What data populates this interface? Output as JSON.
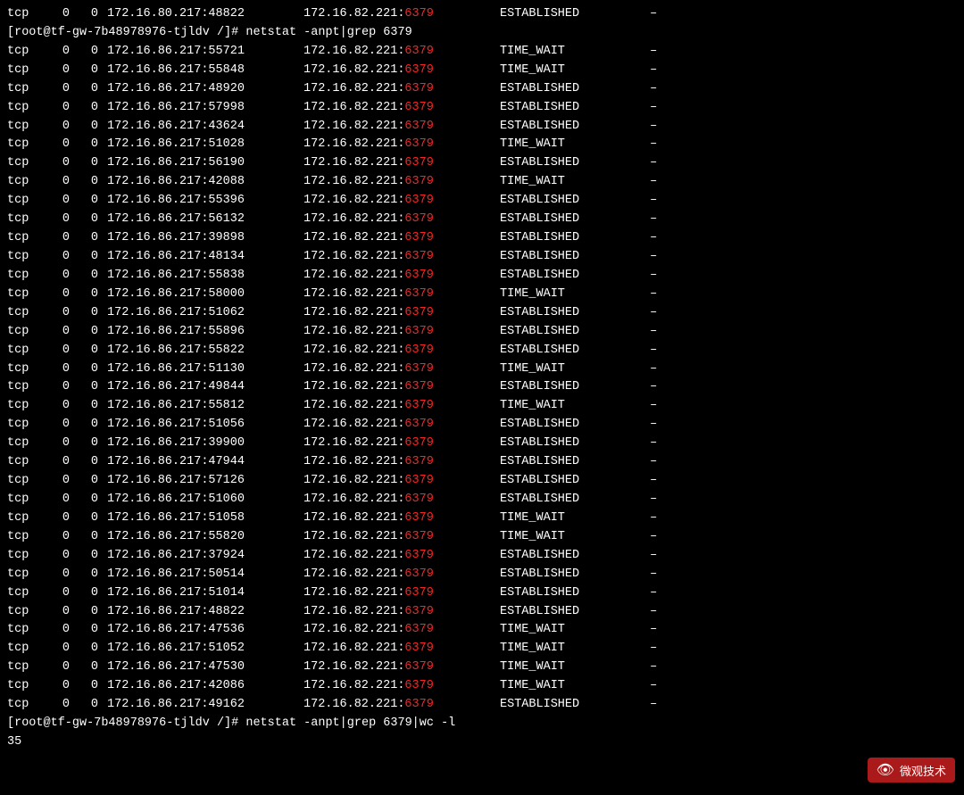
{
  "terminal": {
    "prompt1": "[root@tf-gw-7b48978976-tjldv /]# netstat -anpt|grep 6379",
    "prompt2": "[root@tf-gw-7b48978976-tjldv /]# netstat -anpt|grep 6379|wc -l",
    "count": "35",
    "foreign_base": "172.16.82.221:",
    "port": "6379",
    "rows": [
      {
        "proto": "tcp",
        "recv": "0",
        "send": "0",
        "local": "172.16.86.217:55721",
        "foreign_port": "6379",
        "state": "TIME_WAIT"
      },
      {
        "proto": "tcp",
        "recv": "0",
        "send": "0",
        "local": "172.16.86.217:55848",
        "foreign_port": "6379",
        "state": "TIME_WAIT"
      },
      {
        "proto": "tcp",
        "recv": "0",
        "send": "0",
        "local": "172.16.86.217:48920",
        "foreign_port": "6379",
        "state": "ESTABLISHED"
      },
      {
        "proto": "tcp",
        "recv": "0",
        "send": "0",
        "local": "172.16.86.217:57998",
        "foreign_port": "6379",
        "state": "ESTABLISHED"
      },
      {
        "proto": "tcp",
        "recv": "0",
        "send": "0",
        "local": "172.16.86.217:43624",
        "foreign_port": "6379",
        "state": "ESTABLISHED"
      },
      {
        "proto": "tcp",
        "recv": "0",
        "send": "0",
        "local": "172.16.86.217:51028",
        "foreign_port": "6379",
        "state": "TIME_WAIT"
      },
      {
        "proto": "tcp",
        "recv": "0",
        "send": "0",
        "local": "172.16.86.217:56190",
        "foreign_port": "6379",
        "state": "ESTABLISHED"
      },
      {
        "proto": "tcp",
        "recv": "0",
        "send": "0",
        "local": "172.16.86.217:42088",
        "foreign_port": "6379",
        "state": "TIME_WAIT"
      },
      {
        "proto": "tcp",
        "recv": "0",
        "send": "0",
        "local": "172.16.86.217:55396",
        "foreign_port": "6379",
        "state": "ESTABLISHED"
      },
      {
        "proto": "tcp",
        "recv": "0",
        "send": "0",
        "local": "172.16.86.217:56132",
        "foreign_port": "6379",
        "state": "ESTABLISHED"
      },
      {
        "proto": "tcp",
        "recv": "0",
        "send": "0",
        "local": "172.16.86.217:39898",
        "foreign_port": "6379",
        "state": "ESTABLISHED"
      },
      {
        "proto": "tcp",
        "recv": "0",
        "send": "0",
        "local": "172.16.86.217:48134",
        "foreign_port": "6379",
        "state": "ESTABLISHED"
      },
      {
        "proto": "tcp",
        "recv": "0",
        "send": "0",
        "local": "172.16.86.217:55838",
        "foreign_port": "6379",
        "state": "ESTABLISHED"
      },
      {
        "proto": "tcp",
        "recv": "0",
        "send": "0",
        "local": "172.16.86.217:58000",
        "foreign_port": "6379",
        "state": "TIME_WAIT"
      },
      {
        "proto": "tcp",
        "recv": "0",
        "send": "0",
        "local": "172.16.86.217:51062",
        "foreign_port": "6379",
        "state": "ESTABLISHED"
      },
      {
        "proto": "tcp",
        "recv": "0",
        "send": "0",
        "local": "172.16.86.217:55896",
        "foreign_port": "6379",
        "state": "ESTABLISHED"
      },
      {
        "proto": "tcp",
        "recv": "0",
        "send": "0",
        "local": "172.16.86.217:55822",
        "foreign_port": "6379",
        "state": "ESTABLISHED"
      },
      {
        "proto": "tcp",
        "recv": "0",
        "send": "0",
        "local": "172.16.86.217:51130",
        "foreign_port": "6379",
        "state": "TIME_WAIT"
      },
      {
        "proto": "tcp",
        "recv": "0",
        "send": "0",
        "local": "172.16.86.217:49844",
        "foreign_port": "6379",
        "state": "ESTABLISHED"
      },
      {
        "proto": "tcp",
        "recv": "0",
        "send": "0",
        "local": "172.16.86.217:55812",
        "foreign_port": "6379",
        "state": "TIME_WAIT"
      },
      {
        "proto": "tcp",
        "recv": "0",
        "send": "0",
        "local": "172.16.86.217:51056",
        "foreign_port": "6379",
        "state": "ESTABLISHED"
      },
      {
        "proto": "tcp",
        "recv": "0",
        "send": "0",
        "local": "172.16.86.217:39900",
        "foreign_port": "6379",
        "state": "ESTABLISHED"
      },
      {
        "proto": "tcp",
        "recv": "0",
        "send": "0",
        "local": "172.16.86.217:47944",
        "foreign_port": "6379",
        "state": "ESTABLISHED"
      },
      {
        "proto": "tcp",
        "recv": "0",
        "send": "0",
        "local": "172.16.86.217:57126",
        "foreign_port": "6379",
        "state": "ESTABLISHED"
      },
      {
        "proto": "tcp",
        "recv": "0",
        "send": "0",
        "local": "172.16.86.217:51060",
        "foreign_port": "6379",
        "state": "ESTABLISHED"
      },
      {
        "proto": "tcp",
        "recv": "0",
        "send": "0",
        "local": "172.16.86.217:51058",
        "foreign_port": "6379",
        "state": "TIME_WAIT"
      },
      {
        "proto": "tcp",
        "recv": "0",
        "send": "0",
        "local": "172.16.86.217:55820",
        "foreign_port": "6379",
        "state": "TIME_WAIT"
      },
      {
        "proto": "tcp",
        "recv": "0",
        "send": "0",
        "local": "172.16.86.217:37924",
        "foreign_port": "6379",
        "state": "ESTABLISHED"
      },
      {
        "proto": "tcp",
        "recv": "0",
        "send": "0",
        "local": "172.16.86.217:50514",
        "foreign_port": "6379",
        "state": "ESTABLISHED"
      },
      {
        "proto": "tcp",
        "recv": "0",
        "send": "0",
        "local": "172.16.86.217:51014",
        "foreign_port": "6379",
        "state": "ESTABLISHED"
      },
      {
        "proto": "tcp",
        "recv": "0",
        "send": "0",
        "local": "172.16.86.217:48822",
        "foreign_port": "6379",
        "state": "ESTABLISHED"
      },
      {
        "proto": "tcp",
        "recv": "0",
        "send": "0",
        "local": "172.16.86.217:47536",
        "foreign_port": "6379",
        "state": "TIME_WAIT"
      },
      {
        "proto": "tcp",
        "recv": "0",
        "send": "0",
        "local": "172.16.86.217:51052",
        "foreign_port": "6379",
        "state": "TIME_WAIT"
      },
      {
        "proto": "tcp",
        "recv": "0",
        "send": "0",
        "local": "172.16.86.217:47530",
        "foreign_port": "6379",
        "state": "TIME_WAIT"
      },
      {
        "proto": "tcp",
        "recv": "0",
        "send": "0",
        "local": "172.16.86.217:42086",
        "foreign_port": "6379",
        "state": "TIME_WAIT"
      },
      {
        "proto": "tcp",
        "recv": "0",
        "send": "0",
        "local": "172.16.86.217:49162",
        "foreign_port": "6379",
        "state": "ESTABLISHED"
      }
    ],
    "watermark": {
      "icon": "👁",
      "text": "微观技术"
    }
  }
}
